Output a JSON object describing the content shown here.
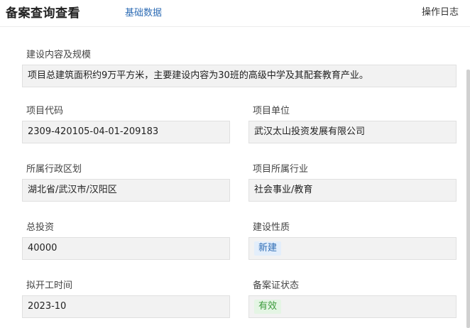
{
  "header": {
    "title": "备案查询查看",
    "tab_basic": "基础数据",
    "op_log": "操作日志"
  },
  "fields": {
    "scope": {
      "label": "建设内容及规模",
      "value": "项目总建筑面积约9万平方米，主要建设内容为30班的高级中学及其配套教育产业。"
    },
    "code": {
      "label": "项目代码",
      "value": "2309-420105-04-01-209183"
    },
    "unit": {
      "label": "项目单位",
      "value": "武汉太山投资发展有限公司"
    },
    "region": {
      "label": "所属行政区划",
      "value": "湖北省/武汉市/汉阳区"
    },
    "industry": {
      "label": "项目所属行业",
      "value": "社会事业/教育"
    },
    "investment": {
      "label": "总投资",
      "value": "40000"
    },
    "nature": {
      "label": "建设性质",
      "value": "新建"
    },
    "start_time": {
      "label": "拟开工时间",
      "value": "2023-10"
    },
    "cert_status": {
      "label": "备案证状态",
      "value": "有效"
    }
  },
  "colors": {
    "link": "#2f6db5",
    "tag_blue_bg": "#e3eefb",
    "tag_green_bg": "#e4f5e4",
    "tag_green_text": "#3b9a3b",
    "field_bg": "#f2f2f2"
  }
}
